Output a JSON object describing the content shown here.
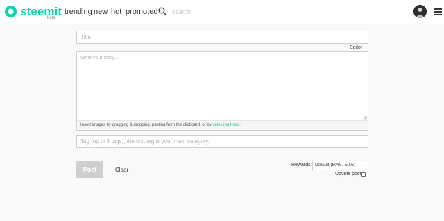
{
  "header": {
    "brand": "steemit",
    "beta_tag": "beta",
    "nav": {
      "trending": "trending",
      "new": "new",
      "hot": "hot",
      "promoted": "promoted"
    },
    "search": {
      "placeholder": "search"
    },
    "brand_color": "#06d6a9",
    "icons": [
      "steemit-logo-icon",
      "search-icon",
      "avatar",
      "hamburger-menu-icon"
    ]
  },
  "editor": {
    "title_placeholder": "Title",
    "editor_toggle": "Editor",
    "story_placeholder": "Write your story...",
    "drop_hint_prefix": "Insert images by dragging & dropping, pasting from the clipboard, or by ",
    "drop_hint_link": "selecting them",
    "drop_hint_suffix": ".",
    "tags_placeholder": "Tag (up to 5 tags), the first tag is your main category."
  },
  "actions": {
    "post_label": "Post",
    "clear_label": "Clear",
    "rewards_label": "Rewards",
    "rewards_value": "Default (50% / 50%)",
    "upvote_label": "Upvote post",
    "upvote_checked": false
  }
}
